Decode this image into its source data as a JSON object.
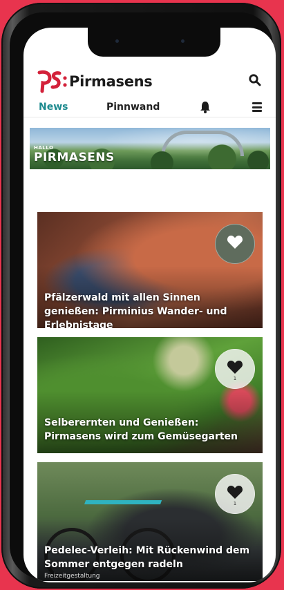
{
  "app": {
    "logo_text": "Pirmasens",
    "logo_mark": "PS:"
  },
  "nav": {
    "news": "News",
    "pinnwand": "Pinnwand"
  },
  "banner": {
    "small_text": "HALLO",
    "big_text": "PIRMASENS"
  },
  "articles": [
    {
      "title": "Pfälzerwald mit allen Sinnen genießen: Pirminius Wander- und Erlebnistage",
      "like_count": "",
      "category": ""
    },
    {
      "title": "Selberernten und Genießen: Pirmasens wird zum Gemüsegarten",
      "like_count": "1",
      "category": ""
    },
    {
      "title": "Pedelec-Verleih: Mit Rückenwind dem Sommer entgegen radeln",
      "like_count": "1",
      "category": "Freizeitgestaltung"
    }
  ],
  "colors": {
    "accent": "#1f8b8f",
    "background": "#e8344e",
    "logo_red": "#d3213a"
  },
  "icons": [
    "search-icon",
    "bell-icon",
    "menu-icon",
    "heart-icon"
  ]
}
